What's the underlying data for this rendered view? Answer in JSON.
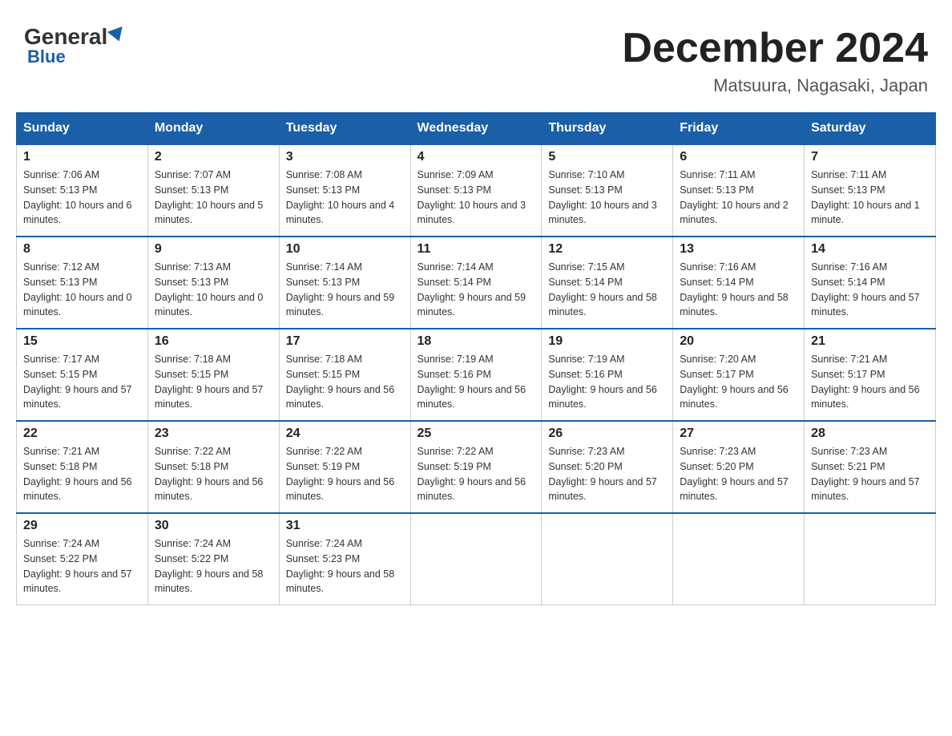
{
  "header": {
    "logo_general": "General",
    "logo_blue": "Blue",
    "month_title": "December 2024",
    "location": "Matsuura, Nagasaki, Japan"
  },
  "days_of_week": [
    "Sunday",
    "Monday",
    "Tuesday",
    "Wednesday",
    "Thursday",
    "Friday",
    "Saturday"
  ],
  "weeks": [
    [
      {
        "day": "1",
        "sunrise": "7:06 AM",
        "sunset": "5:13 PM",
        "daylight": "10 hours and 6 minutes."
      },
      {
        "day": "2",
        "sunrise": "7:07 AM",
        "sunset": "5:13 PM",
        "daylight": "10 hours and 5 minutes."
      },
      {
        "day": "3",
        "sunrise": "7:08 AM",
        "sunset": "5:13 PM",
        "daylight": "10 hours and 4 minutes."
      },
      {
        "day": "4",
        "sunrise": "7:09 AM",
        "sunset": "5:13 PM",
        "daylight": "10 hours and 3 minutes."
      },
      {
        "day": "5",
        "sunrise": "7:10 AM",
        "sunset": "5:13 PM",
        "daylight": "10 hours and 3 minutes."
      },
      {
        "day": "6",
        "sunrise": "7:11 AM",
        "sunset": "5:13 PM",
        "daylight": "10 hours and 2 minutes."
      },
      {
        "day": "7",
        "sunrise": "7:11 AM",
        "sunset": "5:13 PM",
        "daylight": "10 hours and 1 minute."
      }
    ],
    [
      {
        "day": "8",
        "sunrise": "7:12 AM",
        "sunset": "5:13 PM",
        "daylight": "10 hours and 0 minutes."
      },
      {
        "day": "9",
        "sunrise": "7:13 AM",
        "sunset": "5:13 PM",
        "daylight": "10 hours and 0 minutes."
      },
      {
        "day": "10",
        "sunrise": "7:14 AM",
        "sunset": "5:13 PM",
        "daylight": "9 hours and 59 minutes."
      },
      {
        "day": "11",
        "sunrise": "7:14 AM",
        "sunset": "5:14 PM",
        "daylight": "9 hours and 59 minutes."
      },
      {
        "day": "12",
        "sunrise": "7:15 AM",
        "sunset": "5:14 PM",
        "daylight": "9 hours and 58 minutes."
      },
      {
        "day": "13",
        "sunrise": "7:16 AM",
        "sunset": "5:14 PM",
        "daylight": "9 hours and 58 minutes."
      },
      {
        "day": "14",
        "sunrise": "7:16 AM",
        "sunset": "5:14 PM",
        "daylight": "9 hours and 57 minutes."
      }
    ],
    [
      {
        "day": "15",
        "sunrise": "7:17 AM",
        "sunset": "5:15 PM",
        "daylight": "9 hours and 57 minutes."
      },
      {
        "day": "16",
        "sunrise": "7:18 AM",
        "sunset": "5:15 PM",
        "daylight": "9 hours and 57 minutes."
      },
      {
        "day": "17",
        "sunrise": "7:18 AM",
        "sunset": "5:15 PM",
        "daylight": "9 hours and 56 minutes."
      },
      {
        "day": "18",
        "sunrise": "7:19 AM",
        "sunset": "5:16 PM",
        "daylight": "9 hours and 56 minutes."
      },
      {
        "day": "19",
        "sunrise": "7:19 AM",
        "sunset": "5:16 PM",
        "daylight": "9 hours and 56 minutes."
      },
      {
        "day": "20",
        "sunrise": "7:20 AM",
        "sunset": "5:17 PM",
        "daylight": "9 hours and 56 minutes."
      },
      {
        "day": "21",
        "sunrise": "7:21 AM",
        "sunset": "5:17 PM",
        "daylight": "9 hours and 56 minutes."
      }
    ],
    [
      {
        "day": "22",
        "sunrise": "7:21 AM",
        "sunset": "5:18 PM",
        "daylight": "9 hours and 56 minutes."
      },
      {
        "day": "23",
        "sunrise": "7:22 AM",
        "sunset": "5:18 PM",
        "daylight": "9 hours and 56 minutes."
      },
      {
        "day": "24",
        "sunrise": "7:22 AM",
        "sunset": "5:19 PM",
        "daylight": "9 hours and 56 minutes."
      },
      {
        "day": "25",
        "sunrise": "7:22 AM",
        "sunset": "5:19 PM",
        "daylight": "9 hours and 56 minutes."
      },
      {
        "day": "26",
        "sunrise": "7:23 AM",
        "sunset": "5:20 PM",
        "daylight": "9 hours and 57 minutes."
      },
      {
        "day": "27",
        "sunrise": "7:23 AM",
        "sunset": "5:20 PM",
        "daylight": "9 hours and 57 minutes."
      },
      {
        "day": "28",
        "sunrise": "7:23 AM",
        "sunset": "5:21 PM",
        "daylight": "9 hours and 57 minutes."
      }
    ],
    [
      {
        "day": "29",
        "sunrise": "7:24 AM",
        "sunset": "5:22 PM",
        "daylight": "9 hours and 57 minutes."
      },
      {
        "day": "30",
        "sunrise": "7:24 AM",
        "sunset": "5:22 PM",
        "daylight": "9 hours and 58 minutes."
      },
      {
        "day": "31",
        "sunrise": "7:24 AM",
        "sunset": "5:23 PM",
        "daylight": "9 hours and 58 minutes."
      },
      null,
      null,
      null,
      null
    ]
  ]
}
